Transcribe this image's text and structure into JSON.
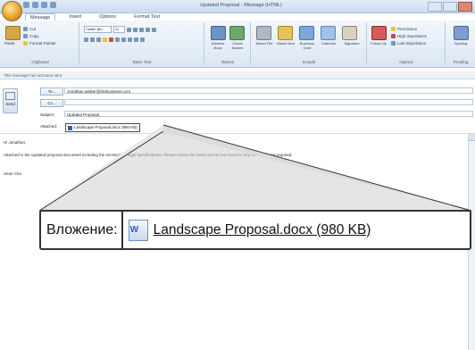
{
  "window": {
    "title": "Updated Proposal - Message (HTML)",
    "qat_icons": [
      "save-icon",
      "undo-icon",
      "redo-icon",
      "customize-icon"
    ]
  },
  "ribbon": {
    "tabs": [
      "Message",
      "Insert",
      "Options",
      "Format Text"
    ],
    "active_tab": "Message",
    "groups": {
      "clipboard": {
        "label": "Clipboard",
        "items": [
          "Paste",
          "Cut",
          "Copy",
          "Format Painter"
        ]
      },
      "basic_text": {
        "label": "Basic Text",
        "font_name": "Calibri (Bo",
        "font_size": "11"
      },
      "names": {
        "label": "Names",
        "items": [
          "Address Book",
          "Check Names"
        ]
      },
      "include": {
        "label": "Include",
        "items": [
          "Attach File",
          "Attach Item",
          "Business Card",
          "Calendar",
          "Signature"
        ]
      },
      "options": {
        "label": "Options",
        "items": [
          "Follow Up",
          "Permission",
          "High Importance",
          "Low Importance"
        ]
      },
      "proofing": {
        "label": "Proofing",
        "items": [
          "Spelling"
        ]
      }
    }
  },
  "infobar": {
    "text": "This message has not been sent."
  },
  "header": {
    "send_label": "Send",
    "to_label": "To...",
    "cc_label": "Cc...",
    "subject_label": "Subject:",
    "attached_label": "Attached:",
    "to_value": "Jonathan.walker@thebusiness.com",
    "cc_value": "",
    "subject_value": "Updated Proposal",
    "attachment_small": "Landscape Proposal.docx (980 KB)"
  },
  "body": {
    "greeting": "Hi Jonathan,",
    "paragraph": "Attached is the updated proposal document including the sections for legal specifications. Please review the same and let me know for any other updates required.",
    "signoff": "Sean Cho"
  },
  "callout": {
    "label": "Вложение:",
    "filename": "Landscape Proposal.docx (980 KB)"
  }
}
